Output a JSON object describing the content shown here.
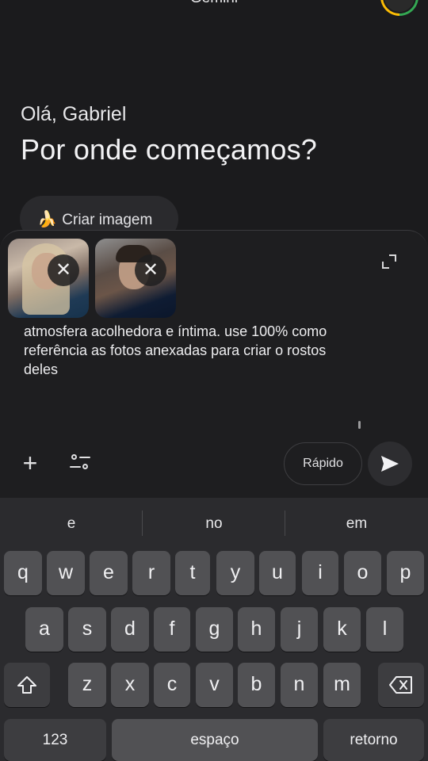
{
  "header": {
    "title": "Gemini"
  },
  "greeting": "Olá, Gabriel",
  "headline": "Por onde começamos?",
  "chip": {
    "emoji": "🍌",
    "label": "Criar imagem"
  },
  "composer": {
    "prompt": "atmosfera acolhedora e íntima. use 100% como referência as fotos anexadas para criar o rostos deles",
    "remove_symbol": "✕",
    "plus_symbol": "+",
    "mode_label": "Rápido"
  },
  "keyboard": {
    "suggestions": [
      "e",
      "no",
      "em"
    ],
    "row1": [
      "q",
      "w",
      "e",
      "r",
      "t",
      "y",
      "u",
      "i",
      "o",
      "p"
    ],
    "row2": [
      "a",
      "s",
      "d",
      "f",
      "g",
      "h",
      "j",
      "k",
      "l"
    ],
    "row3": [
      "z",
      "x",
      "c",
      "v",
      "b",
      "n",
      "m"
    ],
    "numbers_label": "123",
    "space_label": "espaço",
    "return_label": "retorno"
  },
  "colors": {
    "background": "#1b1b1d",
    "keyboard": "#2b2b2e",
    "key": "#515154",
    "chip": "#2a2a2d"
  }
}
